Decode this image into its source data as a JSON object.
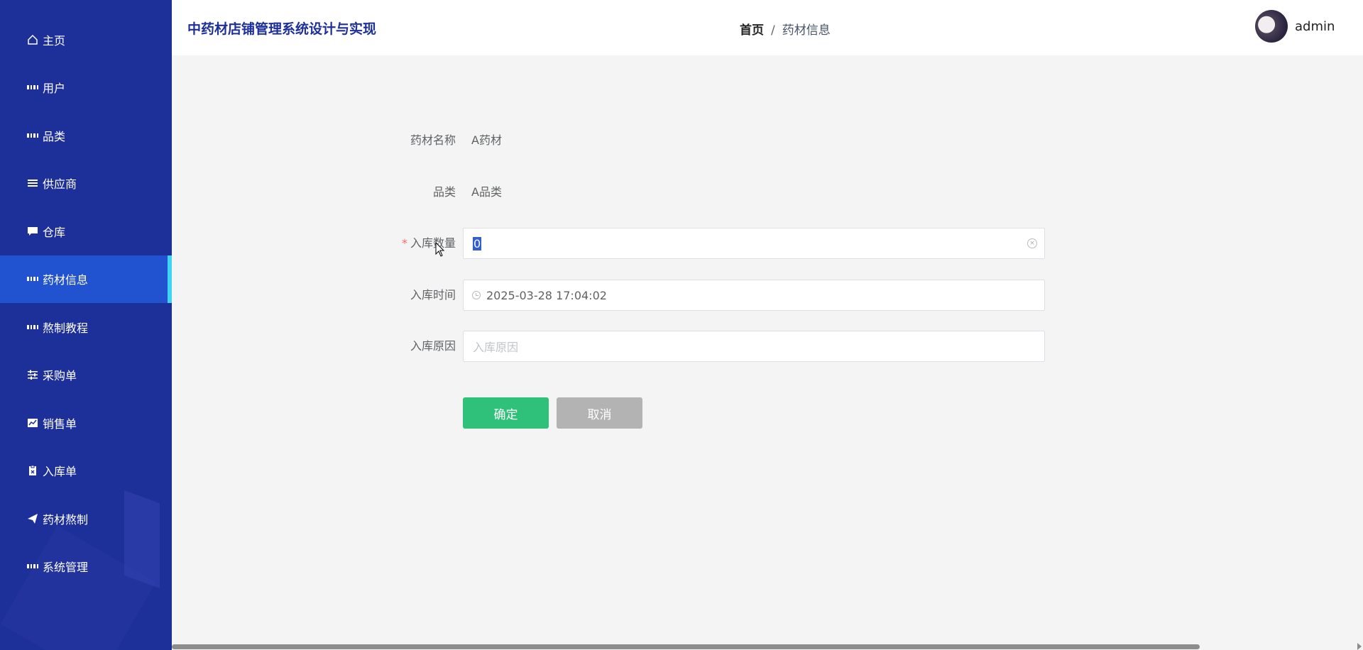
{
  "app": {
    "title": "中药材店铺管理系统设计与实现"
  },
  "sidebar": {
    "items": [
      {
        "label": "主页",
        "icon": "home-icon"
      },
      {
        "label": "用户",
        "icon": "grid-icon"
      },
      {
        "label": "品类",
        "icon": "grid-icon"
      },
      {
        "label": "供应商",
        "icon": "list-icon"
      },
      {
        "label": "仓库",
        "icon": "chat-icon"
      },
      {
        "label": "药材信息",
        "icon": "grid-icon",
        "active": true
      },
      {
        "label": "熬制教程",
        "icon": "grid-icon"
      },
      {
        "label": "采购单",
        "icon": "sliders-icon"
      },
      {
        "label": "销售单",
        "icon": "chart-icon"
      },
      {
        "label": "入库单",
        "icon": "clipboard-icon"
      },
      {
        "label": "药材熬制",
        "icon": "send-icon"
      },
      {
        "label": "系统管理",
        "icon": "grid-icon"
      }
    ]
  },
  "header": {
    "breadcrumb": {
      "home": "首页",
      "separator": "/",
      "current": "药材信息"
    },
    "user": {
      "name": "admin"
    }
  },
  "form": {
    "name": {
      "label": "药材名称",
      "value": "A药材"
    },
    "category": {
      "label": "品类",
      "value": "A品类"
    },
    "quantity": {
      "label": "入库数量",
      "required_mark": "*",
      "value": "0"
    },
    "time": {
      "label": "入库时间",
      "value": "2025-03-28 17:04:02"
    },
    "reason": {
      "label": "入库原因",
      "placeholder": "入库原因",
      "value": ""
    },
    "ok_label": "确定",
    "cancel_label": "取消"
  },
  "colors": {
    "sidebar_bg": "#1d2f98",
    "active_item": "#2152cf",
    "active_indicator": "#41d4f2",
    "ok_button": "#2fc17a",
    "cancel_button": "#b3b3b3"
  }
}
